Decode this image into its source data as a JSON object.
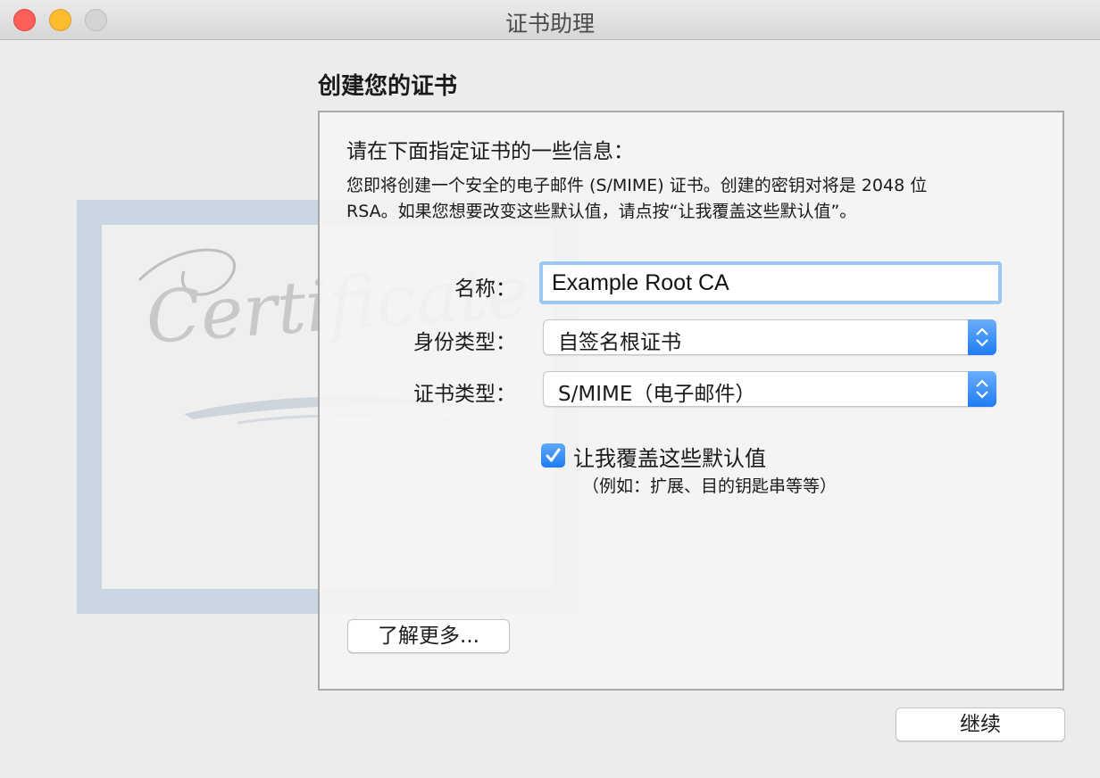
{
  "window": {
    "title": "证书助理"
  },
  "page": {
    "heading": "创建您的证书",
    "subheading": "请在下面指定证书的一些信息：",
    "description_line1": "您即将创建一个安全的电子邮件 (S/MIME) 证书。创建的密钥对将是 2048 位",
    "description_line2": "RSA。如果您想要改变这些默认值，请点按“让我覆盖这些默认值”。"
  },
  "form": {
    "name_label": "名称：",
    "name_value": "Example Root CA",
    "identity_type_label": "身份类型：",
    "identity_type_value": "自签名根证书",
    "cert_type_label": "证书类型：",
    "cert_type_value": "S/MIME（电子邮件）",
    "override_label": "让我覆盖这些默认值",
    "override_checked": true,
    "override_hint": "（例如：扩展、目的钥匙串等等）"
  },
  "buttons": {
    "learn_more": "了解更多...",
    "continue": "继续"
  },
  "illustration": {
    "text": "Certificate"
  },
  "colors": {
    "accent": "#1f7cf2",
    "close": "#fc5f57",
    "minimize": "#fdbc2e",
    "focus_ring": "#9cc6f3"
  }
}
